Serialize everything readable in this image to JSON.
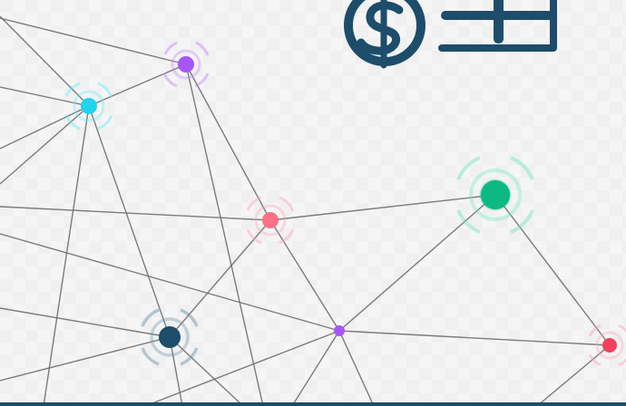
{
  "theme": {
    "background": "#f1f1f2",
    "line": "#6f6f6f",
    "brand": "#1d4d6b"
  },
  "logo": {
    "icon": "dollar-plus-logo-icon",
    "color": "#1d4d6b"
  },
  "nodes": [
    {
      "name": "purple-node",
      "color": "#a855f7",
      "size": "medium",
      "rings": true
    },
    {
      "name": "cyan-node",
      "color": "#22d3ee",
      "size": "medium",
      "rings": true
    },
    {
      "name": "coral-node",
      "color": "#fb7185",
      "size": "medium",
      "rings": true
    },
    {
      "name": "green-node",
      "color": "#10b981",
      "size": "large",
      "rings": true
    },
    {
      "name": "dark-teal-node",
      "color": "#1d4d6b",
      "size": "medium",
      "rings": true
    },
    {
      "name": "small-purple-node",
      "color": "#a855f7",
      "size": "small",
      "rings": false
    },
    {
      "name": "red-node",
      "color": "#f43f5e",
      "size": "small",
      "rings": true
    }
  ]
}
